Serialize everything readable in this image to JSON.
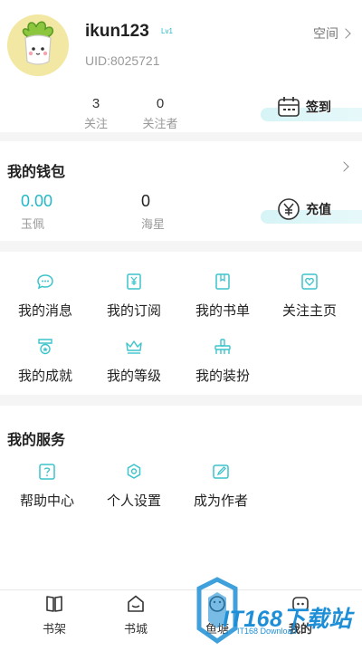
{
  "profile": {
    "username": "ikun123",
    "level_badge": "Lv1",
    "uid": "UID:8025721",
    "space_label": "空间",
    "follow_count": "3",
    "follow_label": "关注",
    "fans_count": "0",
    "fans_label": "关注者",
    "checkin_label": "签到"
  },
  "wallet": {
    "title": "我的钱包",
    "jade_value": "0.00",
    "jade_label": "玉佩",
    "star_value": "0",
    "star_label": "海星",
    "recharge_label": "充值"
  },
  "features": {
    "items": [
      {
        "label": "我的消息",
        "icon": "message-icon"
      },
      {
        "label": "我的订阅",
        "icon": "subscription-icon"
      },
      {
        "label": "我的书单",
        "icon": "booklist-icon"
      },
      {
        "label": "关注主页",
        "icon": "heart-page-icon"
      },
      {
        "label": "我的成就",
        "icon": "medal-icon"
      },
      {
        "label": "我的等级",
        "icon": "crown-icon"
      },
      {
        "label": "我的装扮",
        "icon": "dressup-icon"
      }
    ]
  },
  "services": {
    "title": "我的服务",
    "items": [
      {
        "label": "帮助中心",
        "icon": "help-icon"
      },
      {
        "label": "个人设置",
        "icon": "settings-icon"
      },
      {
        "label": "成为作者",
        "icon": "author-icon"
      }
    ]
  },
  "bottom_nav": {
    "items": [
      {
        "label": "书架",
        "icon": "bookshelf-icon"
      },
      {
        "label": "书城",
        "icon": "bookstore-icon"
      },
      {
        "label": "鱼塘",
        "icon": "pond-icon"
      },
      {
        "label": "我的",
        "icon": "profile-icon"
      }
    ]
  },
  "watermark": {
    "text": "IT168下载站",
    "sub": "IT168 Download"
  },
  "colors": {
    "accent": "#22b8c8",
    "icon_teal": "#3cc4cc",
    "muted_text": "#999999",
    "background": "#f5f5f5"
  }
}
